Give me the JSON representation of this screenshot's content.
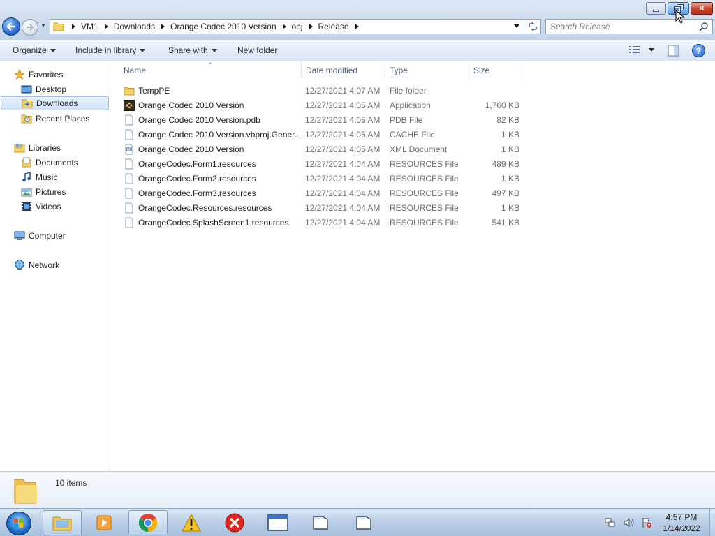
{
  "window": {
    "minimize_icon": "minimize-icon",
    "restore_icon": "restore-icon",
    "close_icon": "close-icon"
  },
  "navigation": {
    "back_icon": "arrow-left-icon",
    "forward_icon": "arrow-right-icon",
    "breadcrumbs": [
      "VM1",
      "Downloads",
      "Orange Codec 2010 Version",
      "obj",
      "Release"
    ],
    "search_placeholder": "Search Release"
  },
  "toolbar": {
    "organize": "Organize",
    "include_in_library": "Include in library",
    "share_with": "Share with",
    "new_folder": "New folder",
    "help": "?"
  },
  "sidebar": {
    "favorites": {
      "label": "Favorites",
      "items": [
        "Desktop",
        "Downloads",
        "Recent Places"
      ]
    },
    "libraries": {
      "label": "Libraries",
      "items": [
        "Documents",
        "Music",
        "Pictures",
        "Videos"
      ]
    },
    "computer": "Computer",
    "network": "Network",
    "selected": "Downloads"
  },
  "columns": {
    "name": "Name",
    "date_modified": "Date modified",
    "type": "Type",
    "size": "Size"
  },
  "files": [
    {
      "name": "TempPE",
      "date": "12/27/2021 4:07 AM",
      "type": "File folder",
      "size": "",
      "icon": "folder-icon"
    },
    {
      "name": "Orange Codec 2010 Version",
      "date": "12/27/2021 4:05 AM",
      "type": "Application",
      "size": "1,760 KB",
      "icon": "application-icon"
    },
    {
      "name": "Orange Codec 2010 Version.pdb",
      "date": "12/27/2021 4:05 AM",
      "type": "PDB File",
      "size": "82 KB",
      "icon": "file-icon"
    },
    {
      "name": "Orange Codec 2010 Version.vbproj.Gener...",
      "date": "12/27/2021 4:05 AM",
      "type": "CACHE File",
      "size": "1 KB",
      "icon": "file-icon"
    },
    {
      "name": "Orange Codec 2010 Version",
      "date": "12/27/2021 4:05 AM",
      "type": "XML Document",
      "size": "1 KB",
      "icon": "xml-document-icon"
    },
    {
      "name": "OrangeCodec.Form1.resources",
      "date": "12/27/2021 4:04 AM",
      "type": "RESOURCES File",
      "size": "489 KB",
      "icon": "file-icon"
    },
    {
      "name": "OrangeCodec.Form2.resources",
      "date": "12/27/2021 4:04 AM",
      "type": "RESOURCES File",
      "size": "1 KB",
      "icon": "file-icon"
    },
    {
      "name": "OrangeCodec.Form3.resources",
      "date": "12/27/2021 4:04 AM",
      "type": "RESOURCES File",
      "size": "497 KB",
      "icon": "file-icon"
    },
    {
      "name": "OrangeCodec.Resources.resources",
      "date": "12/27/2021 4:04 AM",
      "type": "RESOURCES File",
      "size": "1 KB",
      "icon": "file-icon"
    },
    {
      "name": "OrangeCodec.SplashScreen1.resources",
      "date": "12/27/2021 4:04 AM",
      "type": "RESOURCES File",
      "size": "541 KB",
      "icon": "file-icon"
    }
  ],
  "status": {
    "item_count": "10 items"
  },
  "taskbar": {
    "buttons": [
      {
        "icon": "windows-explorer-icon",
        "active": true
      },
      {
        "icon": "media-player-icon",
        "active": false
      },
      {
        "icon": "chrome-icon",
        "active": true
      },
      {
        "icon": "warning-icon",
        "active": false
      },
      {
        "icon": "error-x-icon",
        "active": false
      },
      {
        "icon": "window-icon",
        "active": false
      },
      {
        "icon": "window-icon",
        "active": false
      },
      {
        "icon": "window-icon",
        "active": false
      }
    ],
    "tray_icons": [
      "network-icon",
      "speaker-icon",
      "action-center-flag-icon"
    ],
    "time": "4:57 PM",
    "date": "1/14/2022"
  },
  "colors": {
    "accent": "#2c6fd0",
    "selection": "#cfe2f8",
    "close": "#c4422b",
    "folder": "#f3d36a"
  }
}
